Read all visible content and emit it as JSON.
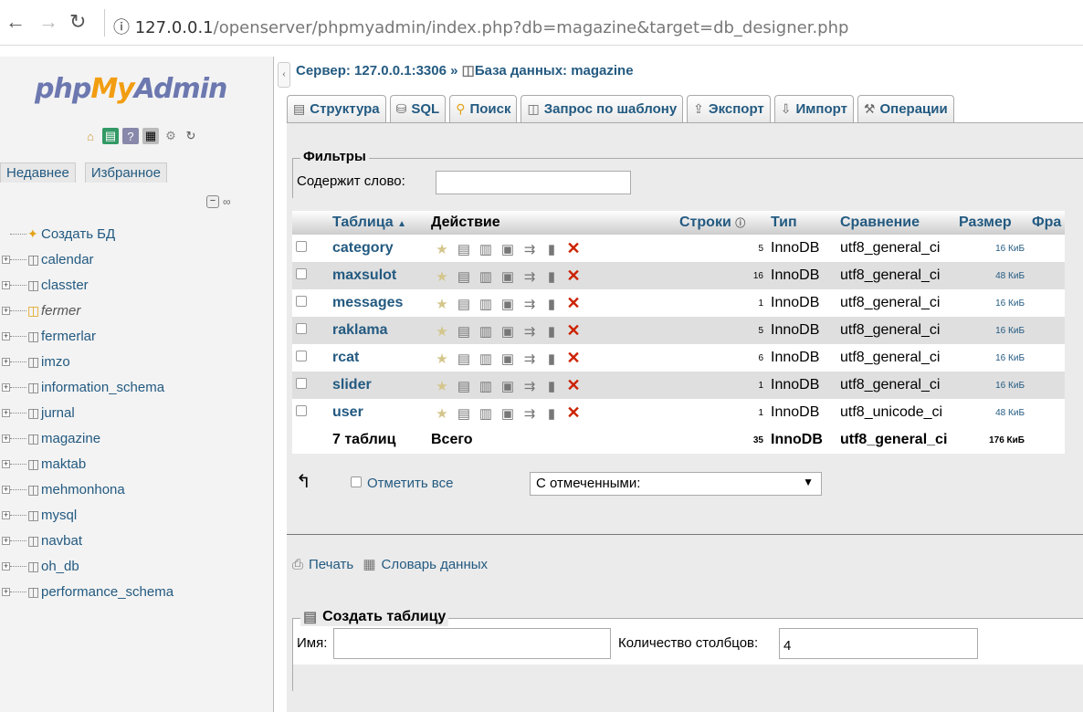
{
  "browser": {
    "url_host": "127.0.0.1",
    "url_path": "/openserver/phpmyadmin/index.php?db=magazine&target=db_designer.php"
  },
  "left": {
    "logo": {
      "php": "php",
      "my": "My",
      "admin": "Admin"
    },
    "tabs": [
      "Недавнее",
      "Избранное"
    ],
    "create_db": "Создать БД",
    "databases": [
      "calendar",
      "classter",
      "fermer",
      "fermerlar",
      "imzo",
      "information_schema",
      "jurnal",
      "magazine",
      "maktab",
      "mehmonhona",
      "mysql",
      "navbat",
      "oh_db",
      "performance_schema"
    ]
  },
  "header": {
    "server_label": "Сервер: 127.0.0.1:3306",
    "sep": "»",
    "db_label": "База данных: magazine"
  },
  "tabs": [
    "Структура",
    "SQL",
    "Поиск",
    "Запрос по шаблону",
    "Экспорт",
    "Импорт",
    "Операции"
  ],
  "filters": {
    "legend": "Фильтры",
    "label": "Содержит слово:"
  },
  "table": {
    "headers": {
      "table": "Таблица",
      "action": "Действие",
      "rows": "Строки",
      "type": "Тип",
      "collation": "Сравнение",
      "size": "Размер",
      "overhead": "Фра"
    },
    "rows": [
      {
        "name": "category",
        "rows": "5",
        "type": "InnoDB",
        "collation": "utf8_general_ci",
        "size": "16 КиБ"
      },
      {
        "name": "maxsulot",
        "rows": "16",
        "type": "InnoDB",
        "collation": "utf8_general_ci",
        "size": "48 КиБ"
      },
      {
        "name": "messages",
        "rows": "1",
        "type": "InnoDB",
        "collation": "utf8_general_ci",
        "size": "16 КиБ"
      },
      {
        "name": "raklama",
        "rows": "5",
        "type": "InnoDB",
        "collation": "utf8_general_ci",
        "size": "16 КиБ"
      },
      {
        "name": "rcat",
        "rows": "6",
        "type": "InnoDB",
        "collation": "utf8_general_ci",
        "size": "16 КиБ"
      },
      {
        "name": "slider",
        "rows": "1",
        "type": "InnoDB",
        "collation": "utf8_general_ci",
        "size": "16 КиБ"
      },
      {
        "name": "user",
        "rows": "1",
        "type": "InnoDB",
        "collation": "utf8_unicode_ci",
        "size": "48 КиБ"
      }
    ],
    "total": {
      "label": "7 таблиц",
      "sum": "Всего",
      "rows": "35",
      "type": "InnoDB",
      "collation": "utf8_general_ci",
      "size": "176 КиБ"
    }
  },
  "bulk": {
    "check_all": "Отметить все",
    "with_selected": "С отмеченными:"
  },
  "links": {
    "print": "Печать",
    "dictionary": "Словарь данных"
  },
  "create_table": {
    "legend": "Создать таблицу",
    "name_label": "Имя:",
    "cols_label": "Количество столбцов:",
    "cols_value": "4"
  }
}
